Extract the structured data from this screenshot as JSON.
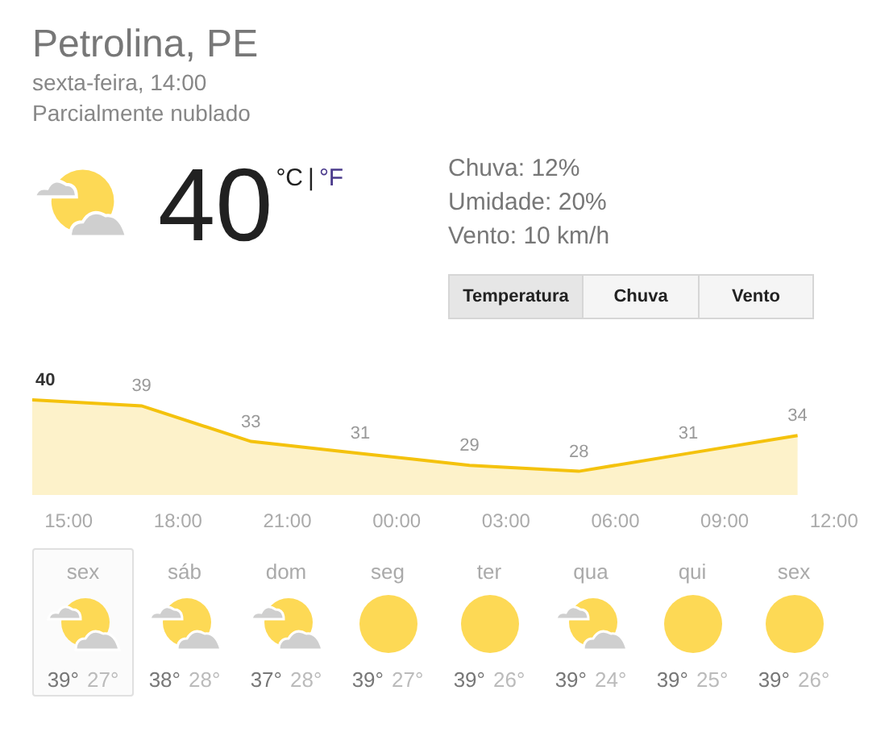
{
  "location": "Petrolina, PE",
  "datetime": "sexta-feira, 14:00",
  "condition": "Parcialmente nublado",
  "current": {
    "kind": "partly_cloudy",
    "temperature": "40",
    "units": [
      {
        "label": "°C",
        "selected": true
      },
      {
        "label": "°F",
        "selected": false
      }
    ],
    "separator": "|"
  },
  "details": [
    "Chuva: 12%",
    "Umidade: 20%",
    "Vento: 10 km/h"
  ],
  "tabs": [
    {
      "label": "Temperatura",
      "selected": true
    },
    {
      "label": "Chuva",
      "selected": false
    },
    {
      "label": "Vento",
      "selected": false
    }
  ],
  "chart_data": {
    "type": "area",
    "categories": [
      null,
      "15:00",
      null,
      null,
      "18:00",
      null,
      null,
      "21:00",
      null,
      null,
      "00:00",
      null,
      null,
      "03:00",
      null,
      null,
      "06:00",
      null,
      null,
      "09:00",
      null,
      null,
      "12:00",
      null
    ],
    "series": [
      {
        "color": "#f4c20d",
        "values": [
          40,
          null,
          null,
          39,
          null,
          null,
          33,
          null,
          null,
          31,
          null,
          null,
          29,
          null,
          null,
          28,
          null,
          null,
          31,
          null,
          null,
          34,
          null,
          null
        ]
      }
    ],
    "data_labels": true
  },
  "forecast": [
    {
      "day": "sex",
      "kind": "partly_cloudy",
      "high": "39°",
      "low": "27°",
      "selected": true
    },
    {
      "day": "sáb",
      "kind": "partly_cloudy",
      "high": "38°",
      "low": "28°",
      "selected": false
    },
    {
      "day": "dom",
      "kind": "partly_cloudy",
      "high": "37°",
      "low": "28°",
      "selected": false
    },
    {
      "day": "seg",
      "kind": "sunny",
      "high": "39°",
      "low": "27°",
      "selected": false
    },
    {
      "day": "ter",
      "kind": "sunny",
      "high": "39°",
      "low": "26°",
      "selected": false
    },
    {
      "day": "qua",
      "kind": "partly_cloudy",
      "high": "39°",
      "low": "24°",
      "selected": false
    },
    {
      "day": "qui",
      "kind": "sunny",
      "high": "39°",
      "low": "25°",
      "selected": false
    },
    {
      "day": "sex",
      "kind": "sunny",
      "high": "39°",
      "low": "26°",
      "selected": false
    }
  ]
}
